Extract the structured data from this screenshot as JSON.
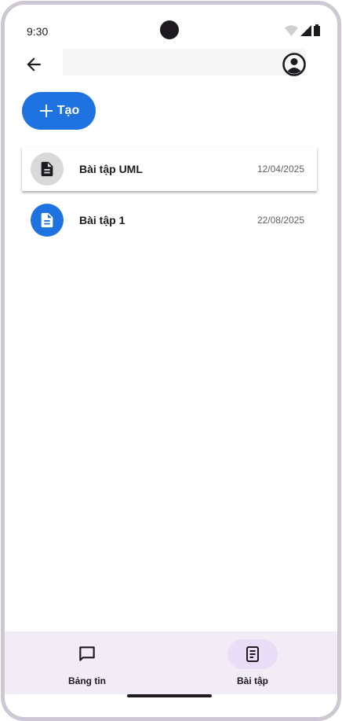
{
  "status_bar": {
    "time": "9:30"
  },
  "actions": {
    "create_label": "Tạo"
  },
  "assignments": [
    {
      "title": "Bài tập UML",
      "date": "12/04/2025",
      "icon": "document-icon",
      "icon_bg": "#d9d9d9"
    },
    {
      "title": "Bài tập 1",
      "date": "22/08/2025",
      "icon": "document-icon",
      "icon_bg": "#1f73e0"
    }
  ],
  "bottom_nav": {
    "items": [
      {
        "label": "Bảng tin",
        "icon": "chat-bubble-icon",
        "active": false
      },
      {
        "label": "Bài tập",
        "icon": "assignment-icon",
        "active": true
      }
    ]
  },
  "colors": {
    "accent": "#1f73e0",
    "nav_bg": "#f2ecf7",
    "active_pill": "#e9ddf8",
    "frame": "#cdc8d3"
  }
}
